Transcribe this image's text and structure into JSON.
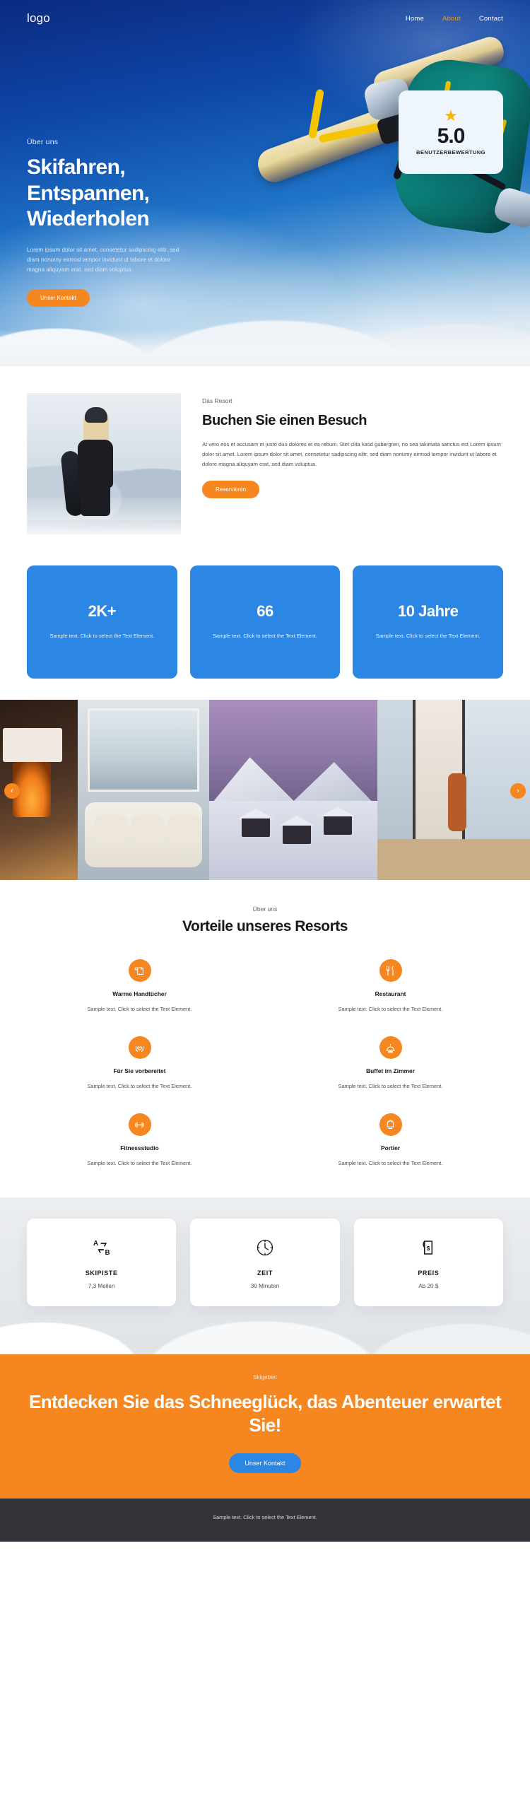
{
  "header": {
    "logo": "logo",
    "nav": [
      {
        "label": "Home",
        "active": false
      },
      {
        "label": "About",
        "active": true
      },
      {
        "label": "Contact",
        "active": false
      }
    ]
  },
  "hero": {
    "eyebrow": "Über uns",
    "heading": "Skifahren, Entspannen, Wiederholen",
    "paragraph": "Lorem ipsum dolor sit amet, consetetur sadipscing elitr, sed diam nonumy eirmod tempor invidunt ut labore et dolore magna aliquyam erat, sed diam voluptua.",
    "cta_label": "Unser Kontakt",
    "rating": {
      "star_icon": "star-icon",
      "value": "5.0",
      "label": "BENUTZERBEWERTUNG"
    }
  },
  "resort": {
    "eyebrow": "Das Resort",
    "heading": "Buchen Sie einen Besuch",
    "paragraph": "At vero eos et accusam et justo duo dolores et ea rebum. Stet clita kasd gubergren, no sea takimata sanctus est Lorem ipsum dolor sit amet. Lorem ipsum dolor sit amet, consetetur sadipscing elitr, sed diam nonumy eirmod tempor invidunt ut labore et dolore magna aliquyam erat, sed diam voluptua.",
    "cta_label": "Reservieren"
  },
  "stats": [
    {
      "number": "2K+",
      "text": "Sample text. Click to select the Text Element."
    },
    {
      "number": "66",
      "text": "Sample text. Click to select the Text Element."
    },
    {
      "number": "10 Jahre",
      "text": "Sample text. Click to select the Text Element."
    }
  ],
  "gallery": {
    "prev_icon": "chevron-left-icon",
    "next_icon": "chevron-right-icon",
    "slides": [
      {
        "alt": "fireplace-lounge"
      },
      {
        "alt": "cozy-living-room-with-snow-view"
      },
      {
        "alt": "snowy-cabins-at-dusk"
      },
      {
        "alt": "chalet-interior-with-window"
      }
    ]
  },
  "benefits": {
    "eyebrow": "Über uns",
    "heading": "Vorteile unseres Resorts",
    "items": [
      {
        "icon": "towel-icon",
        "title": "Warme Handtücher",
        "text": "Sample text. Click to select the Text Element."
      },
      {
        "icon": "cutlery-icon",
        "title": "Restaurant",
        "text": "Sample text. Click to select the Text Element."
      },
      {
        "icon": "hands-heart-icon",
        "title": "Für Sie vorbereitet",
        "text": "Sample text. Click to select the Text Element."
      },
      {
        "icon": "room-service-icon",
        "title": "Buffet im Zimmer",
        "text": "Sample text. Click to select the Text Element."
      },
      {
        "icon": "dumbbell-icon",
        "title": "Fitnessstudio",
        "text": "Sample text. Click to select the Text Element."
      },
      {
        "icon": "bellhop-bell-icon",
        "title": "Portier",
        "text": "Sample text. Click to select the Text Element."
      }
    ]
  },
  "info_cards": [
    {
      "icon": "route-a-to-b-icon",
      "title": "SKIPISTE",
      "value": "7,3 Meilen"
    },
    {
      "icon": "clock-icon",
      "title": "ZEIT",
      "value": "30 Minuten"
    },
    {
      "icon": "price-tag-icon",
      "title": "PREIS",
      "value": "Ab 20 $"
    }
  ],
  "cta": {
    "eyebrow": "Skigebiet",
    "heading": "Entdecken Sie das Schneeglück, das Abenteuer erwartet Sie!",
    "button_label": "Unser Kontakt"
  },
  "footer": {
    "text": "Sample text. Click to select the Text Element."
  },
  "colors": {
    "accent_orange": "#f6861f",
    "accent_blue": "#2b87e3",
    "hero_blue": "#0e47a8",
    "footer_dark": "#33343a"
  }
}
